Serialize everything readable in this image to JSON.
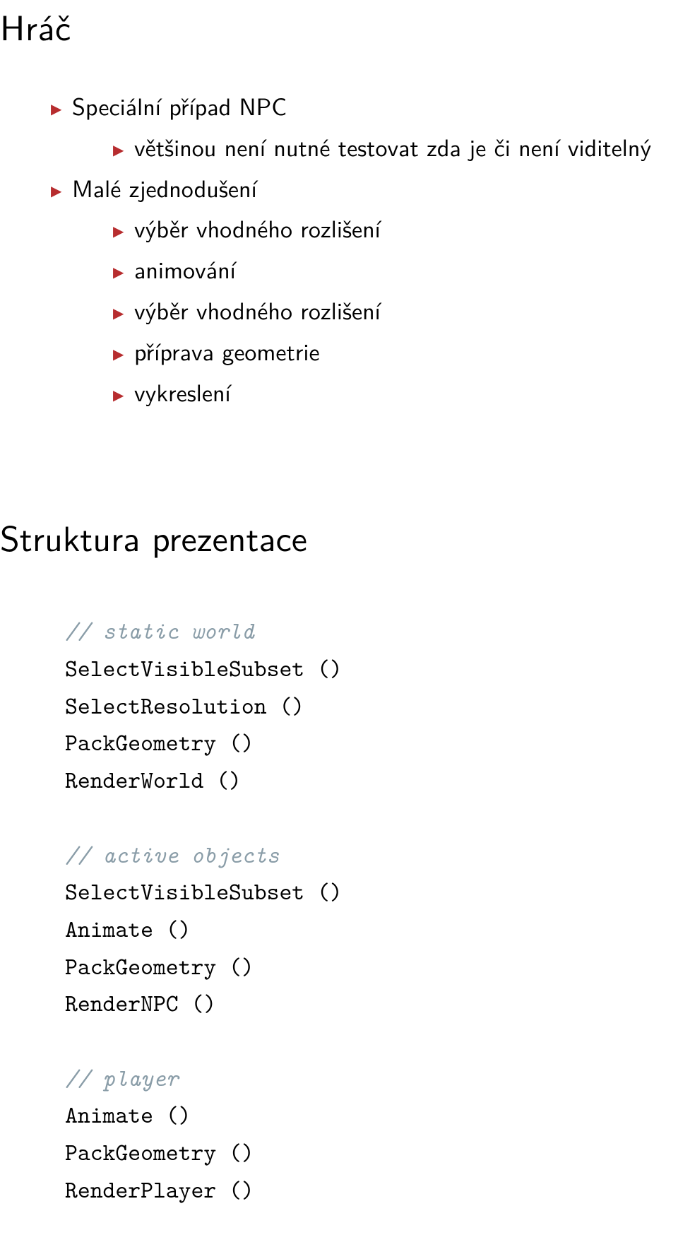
{
  "title": "Hráč",
  "bullets": {
    "l1a": "Speciální případ NPC",
    "l2a": "většinou není nutné testovat zda je či není viditelný",
    "l1b": "Malé zjednodušení",
    "l2b1": "výběr vhodného rozlišení",
    "l2b2": "animování",
    "l2b3": "výběr vhodného rozlišení",
    "l2b4": "příprava geometrie",
    "l2b5": "vykreslení"
  },
  "section_title": "Struktura prezentace",
  "code": {
    "c1": "// static world",
    "l1": "SelectVisibleSubset ()",
    "l2": "SelectResolution ()",
    "l3": "PackGeometry ()",
    "l4": "RenderWorld ()",
    "c2": "// active objects",
    "l5": "SelectVisibleSubset ()",
    "l6": "Animate ()",
    "l7": "PackGeometry ()",
    "l8": "RenderNPC ()",
    "c3": "// player",
    "l9": "Animate ()",
    "l10": "PackGeometry ()",
    "l11": "RenderPlayer ()"
  }
}
